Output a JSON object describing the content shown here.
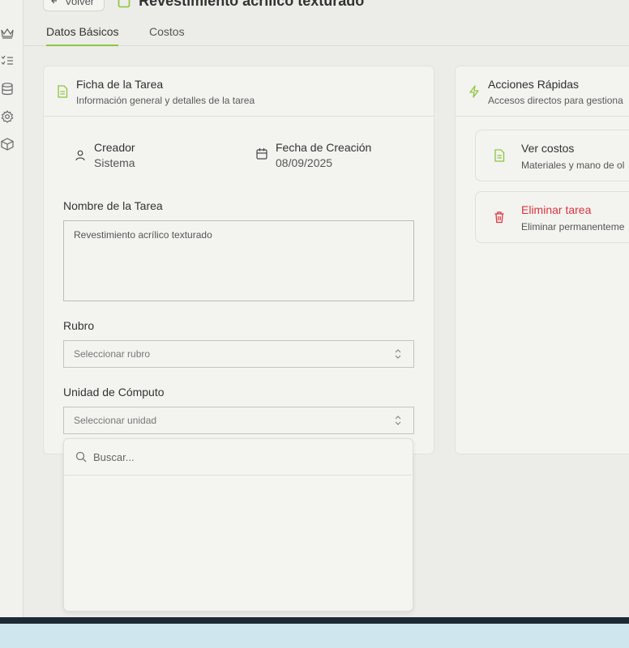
{
  "header": {
    "back_label": "Volver",
    "page_title": "Revestimiento acrílico texturado"
  },
  "tabs": [
    {
      "label": "Datos Básicos",
      "active": true
    },
    {
      "label": "Costos",
      "active": false
    }
  ],
  "sidebar": {
    "icons": [
      "crown-icon",
      "list-check-icon",
      "database-icon",
      "gear-icon",
      "box-icon"
    ]
  },
  "task_card": {
    "title": "Ficha de la Tarea",
    "subtitle": "Información general y detalles de la tarea",
    "creator_label": "Creador",
    "creator_value": "Sistema",
    "created_label": "Fecha de Creación",
    "created_value": "08/09/2025",
    "name_label": "Nombre de la Tarea",
    "name_value": "Revestimiento acrílico texturado",
    "rubro_label": "Rubro",
    "rubro_placeholder": "Seleccionar rubro",
    "unit_label": "Unidad de Cómputo",
    "unit_placeholder": "Seleccionar unidad"
  },
  "dropdown": {
    "search_placeholder": "Buscar..."
  },
  "quick_actions": {
    "title": "Acciones Rápidas",
    "subtitle": "Accesos directos para gestiona",
    "items": [
      {
        "title": "Ver costos",
        "subtitle": "Materiales y mano de ol",
        "color": "#333333"
      },
      {
        "title": "Eliminar tarea",
        "subtitle": "Eliminar permanenteme",
        "color": "#d9363e"
      }
    ]
  },
  "colors": {
    "accent": "#8cc63f",
    "danger": "#d9363e"
  }
}
